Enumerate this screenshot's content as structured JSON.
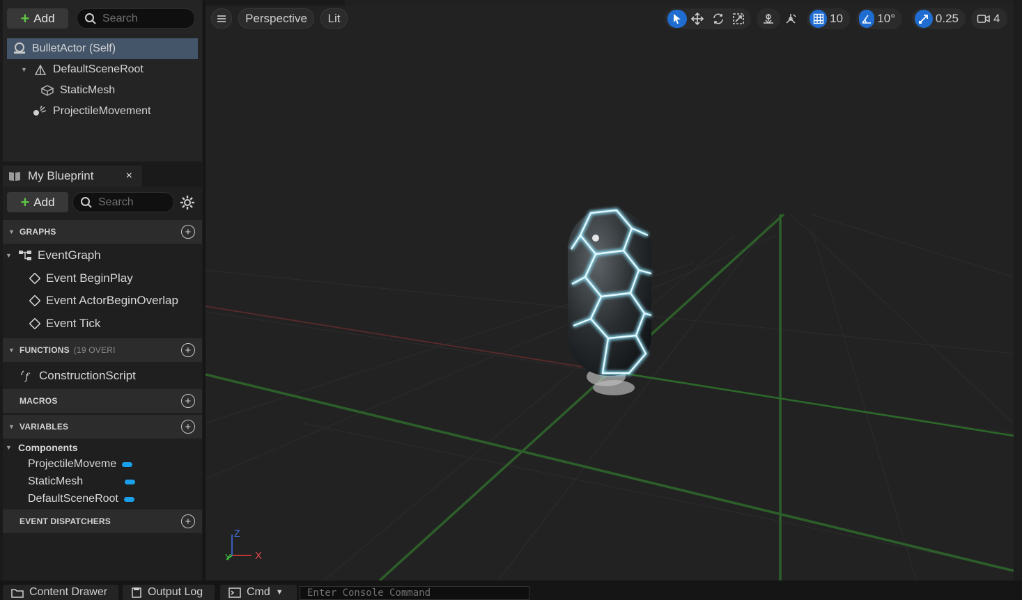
{
  "components": {
    "add_label": "Add",
    "search_placeholder": "Search",
    "tree": [
      {
        "label": "BulletActor (Self)"
      },
      {
        "label": "DefaultSceneRoot"
      },
      {
        "label": "StaticMesh"
      },
      {
        "label": "ProjectileMovement"
      }
    ]
  },
  "blueprint": {
    "tab_label": "My Blueprint",
    "close_label": "×",
    "add_label": "Add",
    "search_placeholder": "Search",
    "sections": {
      "graphs": {
        "label": "GRAPHS"
      },
      "functions": {
        "label": "FUNCTIONS",
        "note": "(19 OVERI"
      },
      "macros": {
        "label": "MACROS"
      },
      "variables": {
        "label": "VARIABLES"
      },
      "dispatchers": {
        "label": "EVENT DISPATCHERS"
      }
    },
    "graphs": {
      "event_graph": "EventGraph",
      "events": [
        "Event BeginPlay",
        "Event ActorBeginOverlap",
        "Event Tick"
      ]
    },
    "functions": [
      "ConstructionScript"
    ],
    "variables": {
      "category": "Components",
      "items": [
        "ProjectileMoveme",
        "StaticMesh",
        "DefaultSceneRoot"
      ],
      "pill_color": "#1aa0ea"
    }
  },
  "viewport": {
    "menu_icon": "hamburger-icon",
    "perspective_label": "Perspective",
    "lit_label": "Lit",
    "grid_snap": "10",
    "rotation_snap": "10°",
    "scale_snap": "0.25",
    "camera_speed": "4",
    "axis": {
      "x": "X",
      "y": "Y",
      "z": "Z"
    },
    "accent_color": "#1f6dd1"
  },
  "bottom": {
    "content_drawer": "Content Drawer",
    "output_log": "Output Log",
    "cmd": "Cmd",
    "console_placeholder": "Enter Console Command"
  }
}
